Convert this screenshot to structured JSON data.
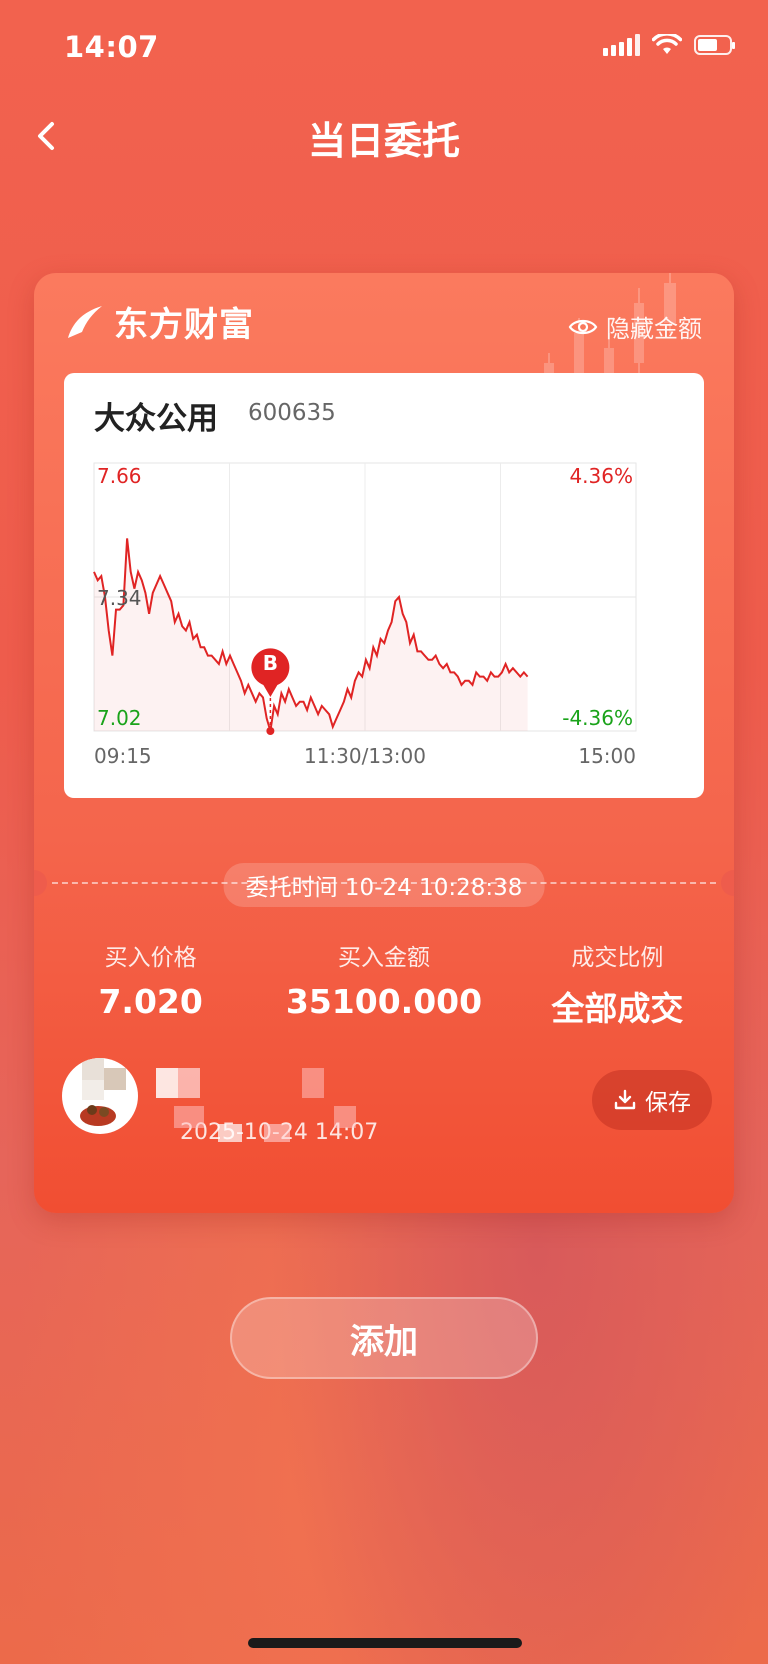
{
  "status_bar": {
    "time": "14:07"
  },
  "nav": {
    "title": "当日委托"
  },
  "card": {
    "brand": "东方财富",
    "hide_amount_label": "隐藏金额",
    "stock": {
      "name": "大众公用",
      "code": "600635"
    },
    "order_time_label": "委托时间 10-24 10:28:38",
    "stats": [
      {
        "label": "买入价格",
        "value": "7.020"
      },
      {
        "label": "买入金额",
        "value": "35100.000"
      },
      {
        "label": "成交比例",
        "value": "全部成交"
      }
    ],
    "user": {
      "timestamp": "2025-10-24 14:07"
    },
    "save_label": "保存"
  },
  "add_button_label": "添加",
  "colors": {
    "up": "#e02424",
    "down": "#1aa31a",
    "line": "#e02424"
  },
  "chart_data": {
    "type": "line",
    "y_left_labels": [
      "7.66",
      "7.34",
      "7.02"
    ],
    "y_right_labels": [
      "4.36%",
      "-4.36%"
    ],
    "x_labels": [
      "09:15",
      "11:30/13:00",
      "15:00"
    ],
    "ylim": [
      7.02,
      7.66
    ],
    "marker": {
      "label": "B",
      "price": 7.02
    },
    "series": [
      {
        "values": [
          7.4,
          7.38,
          7.39,
          7.34,
          7.26,
          7.2,
          7.31,
          7.31,
          7.32,
          7.48,
          7.4,
          7.36,
          7.4,
          7.38,
          7.35,
          7.3,
          7.35,
          7.37,
          7.39,
          7.37,
          7.35,
          7.33,
          7.28,
          7.3,
          7.27,
          7.26,
          7.28,
          7.24,
          7.25,
          7.22,
          7.22,
          7.2,
          7.2,
          7.19,
          7.18,
          7.21,
          7.18,
          7.2,
          7.18,
          7.16,
          7.14,
          7.11,
          7.13,
          7.11,
          7.09,
          7.11,
          7.1,
          7.05,
          7.02,
          7.08,
          7.06,
          7.11,
          7.09,
          7.12,
          7.1,
          7.08,
          7.09,
          7.09,
          7.07,
          7.1,
          7.08,
          7.06,
          7.08,
          7.07,
          7.06,
          7.03,
          7.05,
          7.07,
          7.09,
          7.12,
          7.1,
          7.14,
          7.16,
          7.15,
          7.19,
          7.17,
          7.22,
          7.2,
          7.24,
          7.23,
          7.26,
          7.28,
          7.33,
          7.34,
          7.3,
          7.28,
          7.23,
          7.25,
          7.21,
          7.21,
          7.2,
          7.19,
          7.19,
          7.2,
          7.18,
          7.17,
          7.18,
          7.16,
          7.16,
          7.15,
          7.13,
          7.14,
          7.14,
          7.13,
          7.16,
          7.15,
          7.15,
          7.14,
          7.16,
          7.15,
          7.15,
          7.16,
          7.18,
          7.16,
          7.17,
          7.16,
          7.15,
          7.16,
          7.15
        ]
      }
    ]
  }
}
